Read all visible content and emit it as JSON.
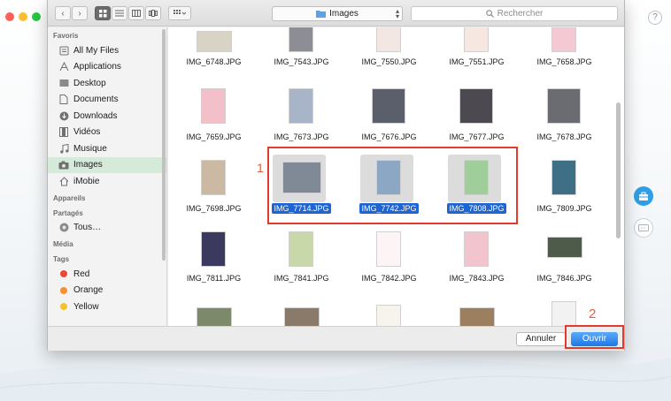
{
  "window": {
    "traffic_colors": [
      "#ff5f57",
      "#febc2e",
      "#28c840"
    ]
  },
  "background_app": {
    "help_label": "?",
    "tool_icons": [
      "toolbox-icon",
      "device-icon"
    ]
  },
  "dialog": {
    "location": "Images",
    "search_placeholder": "Rechercher",
    "view_icons": [
      "icon-view",
      "list-view",
      "column-view",
      "cover-flow-view",
      "group-by-menu"
    ],
    "sidebar": {
      "sections": [
        {
          "title": "Favoris",
          "items": [
            {
              "label": "All My Files",
              "icon": "all-files-icon"
            },
            {
              "label": "Applications",
              "icon": "applications-icon"
            },
            {
              "label": "Desktop",
              "icon": "desktop-icon"
            },
            {
              "label": "Documents",
              "icon": "documents-icon"
            },
            {
              "label": "Downloads",
              "icon": "downloads-icon"
            },
            {
              "label": "Vidéos",
              "icon": "videos-icon"
            },
            {
              "label": "Musique",
              "icon": "music-icon"
            },
            {
              "label": "Images",
              "icon": "images-icon",
              "selected": true
            },
            {
              "label": "iMobie",
              "icon": "home-icon"
            }
          ]
        },
        {
          "title": "Appareils",
          "items": []
        },
        {
          "title": "Partagés",
          "items": [
            {
              "label": "Tous…",
              "icon": "network-icon"
            }
          ]
        },
        {
          "title": "Média",
          "items": []
        },
        {
          "title": "Tags",
          "items": [
            {
              "label": "Red",
              "color": "#f0443a"
            },
            {
              "label": "Orange",
              "color": "#f5922f"
            },
            {
              "label": "Yellow",
              "color": "#f4c22c"
            }
          ]
        }
      ]
    },
    "files": [
      [
        "IMG_6748.JPG",
        "IMG_7543.JPG",
        "IMG_7550.JPG",
        "IMG_7551.JPG",
        "IMG_7658.JPG"
      ],
      [
        "IMG_7659.JPG",
        "IMG_7673.JPG",
        "IMG_7676.JPG",
        "IMG_7677.JPG",
        "IMG_7678.JPG"
      ],
      [
        "IMG_7698.JPG",
        "IMG_7714.JPG",
        "IMG_7742.JPG",
        "IMG_7808.JPG",
        "IMG_7809.JPG"
      ],
      [
        "IMG_7811.JPG",
        "IMG_7841.JPG",
        "IMG_7842.JPG",
        "IMG_7843.JPG",
        "IMG_7846.JPG"
      ],
      [
        "",
        "",
        "",
        "",
        ""
      ]
    ],
    "selected_files": [
      "IMG_7714.JPG",
      "IMG_7742.JPG",
      "IMG_7808.JPG"
    ],
    "buttons": {
      "cancel": "Annuler",
      "open": "Ouvrir"
    }
  },
  "annotations": {
    "step1": "1",
    "step2": "2",
    "highlight_color": "#e23b2d"
  }
}
